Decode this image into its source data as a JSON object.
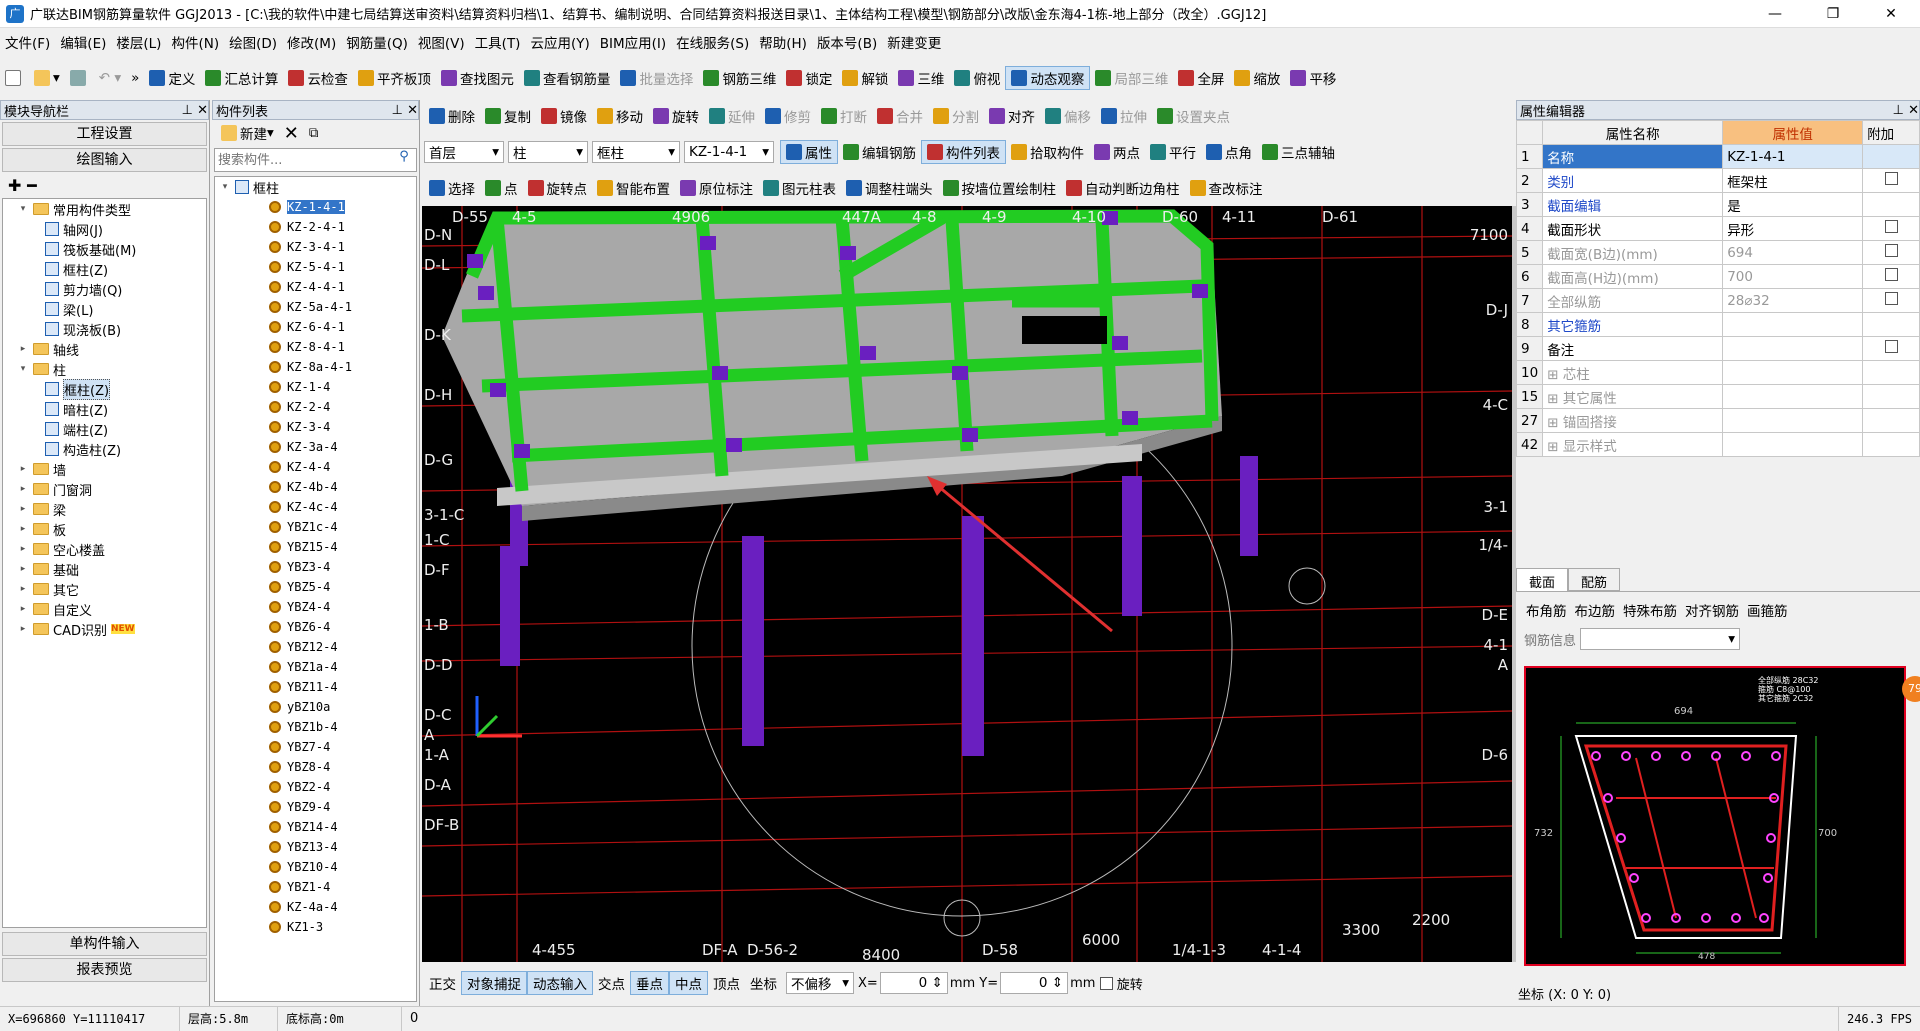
{
  "title": {
    "app_icon": "广",
    "text": "广联达BIM钢筋算量软件 GGJ2013 - [C:\\我的软件\\中建七局结算送审资料\\结算资料归档\\1、结算书、编制说明、合同结算资料报送目录\\1、主体结构工程\\模型\\钢筋部分\\改版\\金东海4-1栋-地上部分（改全）.GGJ12]"
  },
  "menu": [
    "文件(F)",
    "编辑(E)",
    "楼层(L)",
    "构件(N)",
    "绘图(D)",
    "修改(M)",
    "钢筋量(Q)",
    "视图(V)",
    "工具(T)",
    "云应用(Y)",
    "BIM应用(I)",
    "在线服务(S)",
    "帮助(H)",
    "版本号(B)",
    "新建变更"
  ],
  "toolbar1": [
    "定义",
    "汇总计算",
    "云检查",
    "平齐板顶",
    "查找图元",
    "查看钢筋量",
    "批量选择",
    "钢筋三维",
    "锁定",
    "解锁",
    "三维",
    "俯视",
    "动态观察",
    "局部三维",
    "全屏",
    "缩放",
    "平移"
  ],
  "toolbar2": [
    "删除",
    "复制",
    "镜像",
    "移动",
    "旋转",
    "延伸",
    "修剪",
    "打断",
    "合并",
    "分割",
    "对齐",
    "偏移",
    "拉伸",
    "设置夹点"
  ],
  "toolbar3": {
    "floor": "首层",
    "type": "柱",
    "subtype": "框柱",
    "name": "KZ-1-4-1",
    "buttons": [
      "属性",
      "编辑钢筋",
      "构件列表",
      "拾取构件",
      "两点",
      "平行",
      "点角",
      "三点辅轴"
    ]
  },
  "toolbar4": [
    "选择",
    "点",
    "旋转点",
    "智能布置",
    "原位标注",
    "图元柱表",
    "调整柱端头",
    "按墙位置绘制柱",
    "自动判断边角柱",
    "查改标注"
  ],
  "nav": {
    "title": "模块导航栏",
    "btn1": "工程设置",
    "btn2": "绘图输入",
    "btn3": "单构件输入",
    "btn4": "报表预览",
    "tree": [
      {
        "label": "常用构件类型",
        "level": 0,
        "folder": true,
        "exp": "▾"
      },
      {
        "label": "轴网(J)",
        "level": 1
      },
      {
        "label": "筏板基础(M)",
        "level": 1
      },
      {
        "label": "框柱(Z)",
        "level": 1
      },
      {
        "label": "剪力墙(Q)",
        "level": 1
      },
      {
        "label": "梁(L)",
        "level": 1
      },
      {
        "label": "现浇板(B)",
        "level": 1
      },
      {
        "label": "轴线",
        "level": 0,
        "folder": true,
        "exp": "▸"
      },
      {
        "label": "柱",
        "level": 0,
        "folder": true,
        "exp": "▾"
      },
      {
        "label": "框柱(Z)",
        "level": 1,
        "selected": true
      },
      {
        "label": "暗柱(Z)",
        "level": 1
      },
      {
        "label": "端柱(Z)",
        "level": 1
      },
      {
        "label": "构造柱(Z)",
        "level": 1
      },
      {
        "label": "墙",
        "level": 0,
        "folder": true,
        "exp": "▸"
      },
      {
        "label": "门窗洞",
        "level": 0,
        "folder": true,
        "exp": "▸"
      },
      {
        "label": "梁",
        "level": 0,
        "folder": true,
        "exp": "▸"
      },
      {
        "label": "板",
        "level": 0,
        "folder": true,
        "exp": "▸"
      },
      {
        "label": "空心楼盖",
        "level": 0,
        "folder": true,
        "exp": "▸"
      },
      {
        "label": "基础",
        "level": 0,
        "folder": true,
        "exp": "▸"
      },
      {
        "label": "其它",
        "level": 0,
        "folder": true,
        "exp": "▸"
      },
      {
        "label": "自定义",
        "level": 0,
        "folder": true,
        "exp": "▸"
      },
      {
        "label": "CAD识别",
        "level": 0,
        "folder": true,
        "exp": "▸",
        "badge": "NEW"
      }
    ]
  },
  "complist": {
    "title": "构件列表",
    "new_label": "新建",
    "search_placeholder": "搜索构件...",
    "root": "框柱",
    "items": [
      "KZ-1-4-1",
      "KZ-2-4-1",
      "KZ-3-4-1",
      "KZ-5-4-1",
      "KZ-4-4-1",
      "KZ-5a-4-1",
      "KZ-6-4-1",
      "KZ-8-4-1",
      "KZ-8a-4-1",
      "KZ-1-4",
      "KZ-2-4",
      "KZ-3-4",
      "KZ-3a-4",
      "KZ-4-4",
      "KZ-4b-4",
      "KZ-4c-4",
      "YBZ1c-4",
      "YBZ15-4",
      "YBZ3-4",
      "YBZ5-4",
      "YBZ4-4",
      "YBZ6-4",
      "YBZ12-4",
      "YBZ1a-4",
      "YBZ11-4",
      "yBZ10a",
      "YBZ1b-4",
      "YBZ7-4",
      "YBZ8-4",
      "YBZ2-4",
      "YBZ9-4",
      "YBZ14-4",
      "YBZ13-4",
      "YBZ10-4",
      "YBZ1-4",
      "KZ-4a-4",
      "KZ1-3"
    ]
  },
  "viewport": {
    "top_labels": [
      "D-55",
      "4-5",
      "4906",
      "447A",
      "4-8",
      "4-9",
      "4-10",
      "D-60",
      "4-11",
      "D-61"
    ],
    "left_labels": [
      "D-N",
      "D-L",
      "D-K",
      "D-H",
      "D-G",
      "3-1-C",
      "1-C",
      "D-F",
      "1-B",
      "D-D",
      "D-C",
      "A",
      "1-A",
      "D-A",
      "DF-B"
    ],
    "right_labels": [
      "7100",
      "D-J",
      "4-C",
      "3-1",
      "1/4-",
      "D-E",
      "4-1",
      "A",
      "D-6"
    ],
    "bottom_labels": [
      "4-455",
      "DF-A",
      "D-56-2",
      "8400",
      "D-58",
      "6000",
      "1/4-1-3",
      "4-1-4",
      "3300",
      "2200"
    ]
  },
  "bottom_toolbar": {
    "buttons": [
      "正交",
      "对象捕捉",
      "动态输入",
      "交点",
      "垂点",
      "中点",
      "顶点",
      "坐标"
    ],
    "offset_mode": "不偏移",
    "x_label": "X=",
    "x_val": "0",
    "unit1": "mm",
    "y_label": "Y=",
    "y_val": "0",
    "unit2": "mm",
    "rotate": "旋转"
  },
  "props": {
    "title": "属性编辑器",
    "col_name": "属性名称",
    "col_val": "属性值",
    "col_extra": "附加",
    "rows": [
      {
        "n": "1",
        "name": "名称",
        "val": "KZ-1-4-1",
        "chk": false,
        "style": "blue",
        "selected": true
      },
      {
        "n": "2",
        "name": "类别",
        "val": "框架柱",
        "chk": true,
        "style": "blue"
      },
      {
        "n": "3",
        "name": "截面编辑",
        "val": "是",
        "chk": false,
        "style": "blue"
      },
      {
        "n": "4",
        "name": "截面形状",
        "val": "异形",
        "chk": true,
        "style": ""
      },
      {
        "n": "5",
        "name": "截面宽(B边)(mm)",
        "val": "694",
        "chk": true,
        "style": "gray"
      },
      {
        "n": "6",
        "name": "截面高(H边)(mm)",
        "val": "700",
        "chk": true,
        "style": "gray"
      },
      {
        "n": "7",
        "name": "全部纵筋",
        "val": "28⌀32",
        "chk": true,
        "style": "gray"
      },
      {
        "n": "8",
        "name": "其它箍筋",
        "val": "",
        "chk": false,
        "style": "blue"
      },
      {
        "n": "9",
        "name": "备注",
        "val": "",
        "chk": true,
        "style": ""
      },
      {
        "n": "10",
        "name": "芯柱",
        "val": "",
        "chk": false,
        "style": "gray",
        "plus": true
      },
      {
        "n": "15",
        "name": "其它属性",
        "val": "",
        "chk": false,
        "style": "gray",
        "plus": true
      },
      {
        "n": "27",
        "name": "锚固搭接",
        "val": "",
        "chk": false,
        "style": "gray",
        "plus": true
      },
      {
        "n": "42",
        "name": "显示样式",
        "val": "",
        "chk": false,
        "style": "gray",
        "plus": true
      }
    ]
  },
  "section": {
    "tab1": "截面",
    "tab2": "配筋",
    "rebar_tools": [
      "布角筋",
      "布边筋",
      "特殊布筋",
      "对齐钢筋",
      "画箍筋"
    ],
    "rebar_info_label": "钢筋信息",
    "legend": [
      "全部纵筋 28C32",
      "箍筋 C8@100",
      "其它箍筋 2C32"
    ],
    "dims": {
      "top": "694",
      "left": "732",
      "right": "700",
      "bottom": "478"
    },
    "badge": "79"
  },
  "status": {
    "coord": "X=696860 Y=11110417",
    "floor_h": "层高:5.8m",
    "base_h": "底标高:0m",
    "zero": "0",
    "fps": "246.3 FPS",
    "panel_coord": "坐标 (X: 0 Y: 0)"
  }
}
